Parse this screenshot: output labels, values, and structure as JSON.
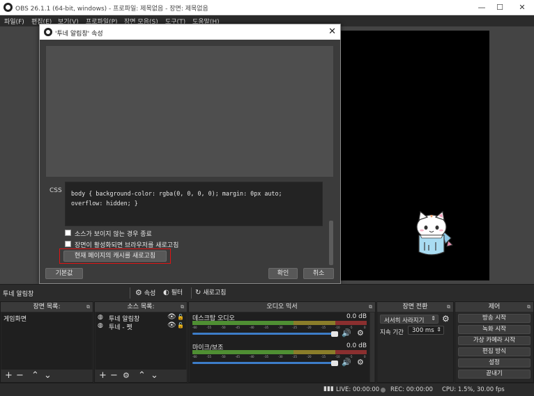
{
  "window": {
    "title": "OBS 26.1.1 (64-bit, windows) - 프로파일: 제목없음 - 장면: 제목없음",
    "minimize": "—",
    "maximize": "☐",
    "close": "✕"
  },
  "menu": [
    "파일(F)",
    "편집(E)",
    "보기(V)",
    "프로파일(P)",
    "장면 모음(S)",
    "도구(T)",
    "도움말(H)"
  ],
  "dialog": {
    "title": "'투네 알림창' 속성",
    "close": "✕",
    "css_label": "CSS",
    "css_code": "body { background-color: rgba(0, 0, 0, 0); margin: 0px auto;\noverflow: hidden; }",
    "checkbox_shutdown": "소스가 보이지 않는 경우 종료",
    "checkbox_refresh": "장면이 활성화되면 브라우저를 새로고침",
    "refresh_cache_button": "현재 페이지의 캐시를 새로고침",
    "defaults_button": "기본값",
    "ok_button": "확인",
    "cancel_button": "취소"
  },
  "toolbar": {
    "source_name": "투네 알림창",
    "properties": "속성",
    "filters": "필터",
    "refresh": "새로고침"
  },
  "scenes": {
    "header": "장면 목록:",
    "items": [
      "게임화면"
    ]
  },
  "sources": {
    "header": "소스 목록:",
    "items": [
      "투네 알림창",
      "투네 - 펫"
    ]
  },
  "mixer": {
    "header": "오디오 믹서",
    "channels": [
      {
        "name": "데스크탑 오디오",
        "db": "0.0 dB"
      },
      {
        "name": "마이크/보조",
        "db": "0.0 dB"
      }
    ],
    "scale": [
      "-60",
      "-55",
      "-50",
      "-45",
      "-40",
      "-35",
      "-30",
      "-25",
      "-20",
      "-15",
      "-10",
      "-5",
      "0"
    ]
  },
  "transitions": {
    "header": "장면 전환",
    "type": "서서히 사라지기",
    "duration_label": "지속 기간",
    "duration_value": "300 ms"
  },
  "controls": {
    "header": "제어",
    "buttons": [
      "방송 시작",
      "녹화 시작",
      "가상 카메라 시작",
      "편집 방식",
      "설정",
      "끝내기"
    ]
  },
  "status": {
    "live": "LIVE: 00:00:00",
    "rec": "REC: 00:00:00",
    "cpu": "CPU: 1.5%, 30.00 fps"
  },
  "colors": {
    "accent_red": "#e01414",
    "meter_green": "#4f8f33",
    "slider_blue": "#3d7dc8"
  }
}
